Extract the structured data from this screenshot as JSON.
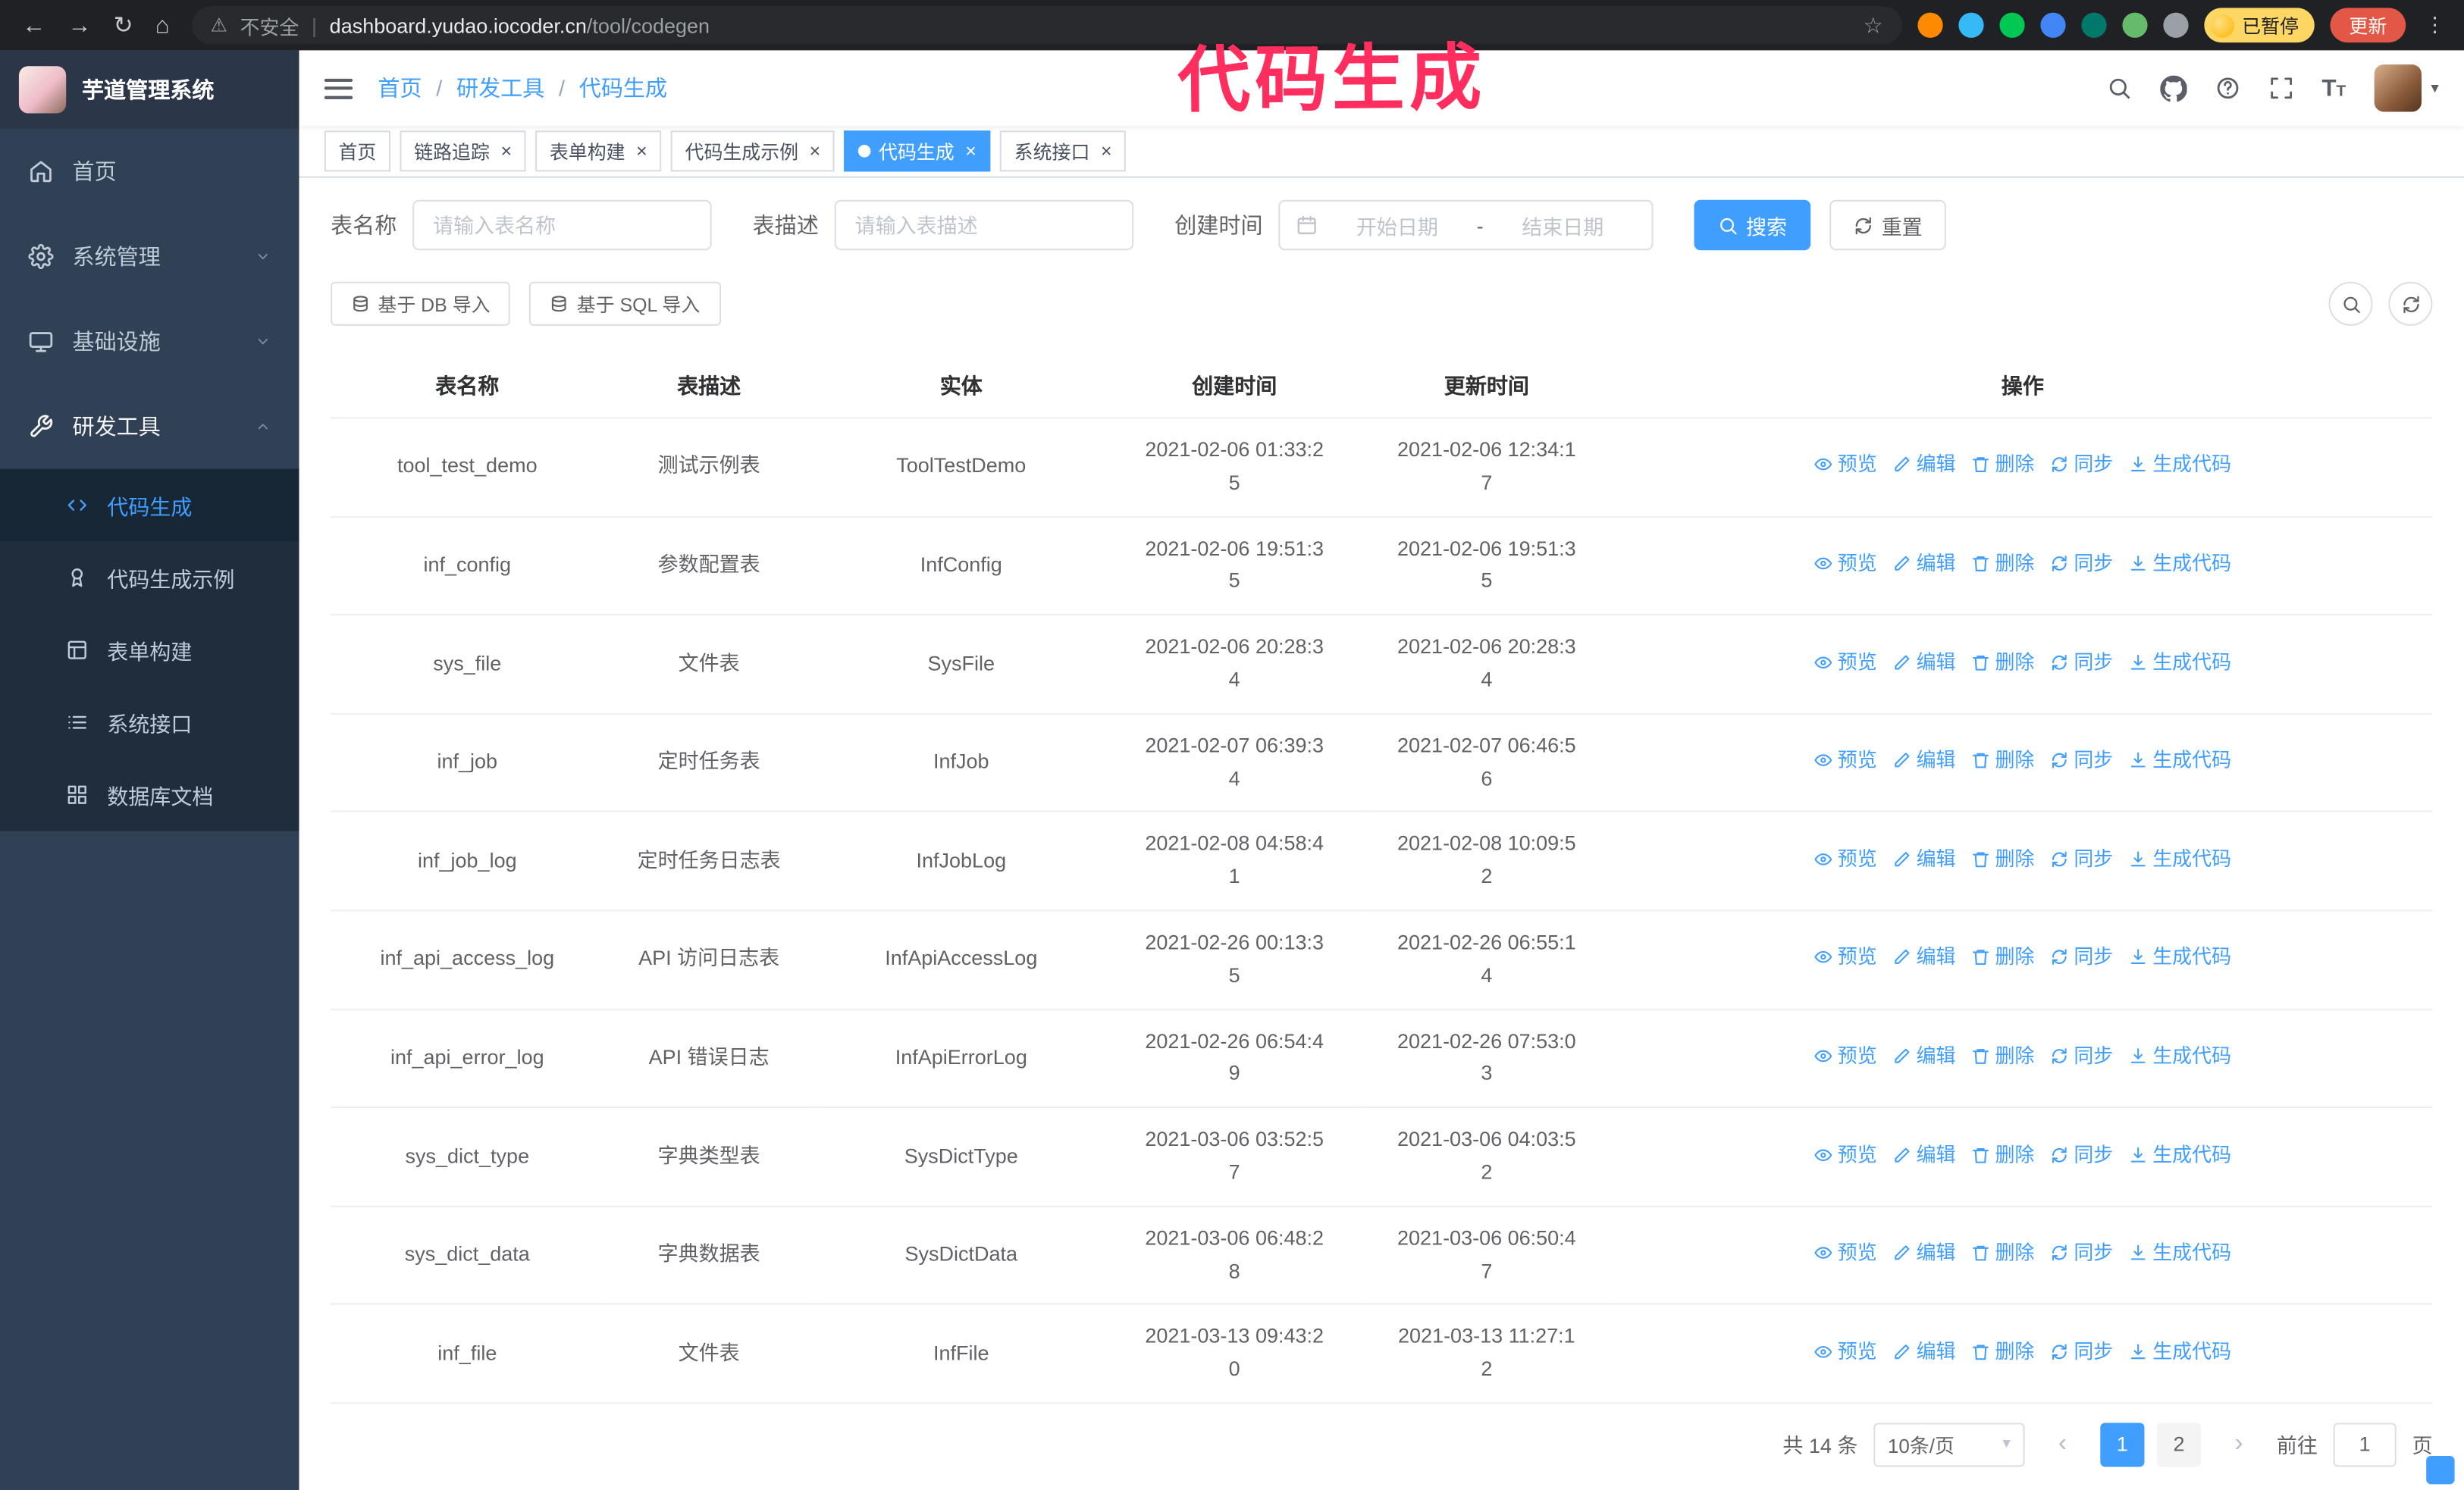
{
  "theme": {
    "accent": "#409eff",
    "sidebar_bg": "#304156",
    "annotation_color": "#ff2e5f",
    "active_tab_bg": "#409eff",
    "update_button_bg": "#e25746",
    "paused_chip_bg": "#fdd663"
  },
  "browser": {
    "security_label": "不安全",
    "url_domain": "dashboard.yudao.iocoder.cn",
    "url_path": "/tool/codegen",
    "paused_badge": "已暂停",
    "update_button": "更新",
    "extensions": [
      {
        "name": "orange-extension-icon",
        "color": "#ff8a00"
      },
      {
        "name": "blue-drop-extension-icon",
        "color": "#35baf6"
      },
      {
        "name": "green-check-extension-icon",
        "color": "#00c853"
      },
      {
        "name": "blue-square-extension-icon",
        "color": "#4285f4"
      },
      {
        "name": "teal-extension-icon",
        "color": "#00796b"
      },
      {
        "name": "green-leaf-extension-icon",
        "color": "#66bb6a"
      },
      {
        "name": "puzzle-extension-icon",
        "color": "#9aa0a6"
      }
    ]
  },
  "annotation": {
    "text": "代码生成"
  },
  "sidebar": {
    "logo_title": "芋道管理系统",
    "menu": [
      {
        "label": "首页",
        "icon": "dashboard-icon",
        "expandable": false,
        "expanded": false
      },
      {
        "label": "系统管理",
        "icon": "gear-icon",
        "expandable": true,
        "expanded": false
      },
      {
        "label": "基础设施",
        "icon": "infra-icon",
        "expandable": true,
        "expanded": false
      },
      {
        "label": "研发工具",
        "icon": "tools-icon",
        "expandable": true,
        "expanded": true
      }
    ],
    "submenu": [
      {
        "label": "代码生成",
        "icon": "code-icon",
        "active": true
      },
      {
        "label": "代码生成示例",
        "icon": "example-icon",
        "active": false
      },
      {
        "label": "表单构建",
        "icon": "form-icon",
        "active": false
      },
      {
        "label": "系统接口",
        "icon": "api-icon",
        "active": false
      },
      {
        "label": "数据库文档",
        "icon": "db-icon",
        "active": false
      }
    ]
  },
  "header": {
    "breadcrumb": [
      {
        "label": "首页"
      },
      {
        "label": "研发工具"
      },
      {
        "label": "代码生成"
      }
    ],
    "icons": [
      "search-icon",
      "github-icon",
      "question-icon",
      "fullscreen-icon",
      "font-size-icon"
    ]
  },
  "tabs": [
    {
      "label": "首页",
      "closable": false,
      "active": false
    },
    {
      "label": "链路追踪",
      "closable": true,
      "active": false
    },
    {
      "label": "表单构建",
      "closable": true,
      "active": false
    },
    {
      "label": "代码生成示例",
      "closable": true,
      "active": false
    },
    {
      "label": "代码生成",
      "closable": true,
      "active": true
    },
    {
      "label": "系统接口",
      "closable": true,
      "active": false
    }
  ],
  "filters": {
    "table_name_label": "表名称",
    "table_name_placeholder": "请输入表名称",
    "table_desc_label": "表描述",
    "table_desc_placeholder": "请输入表描述",
    "create_time_label": "创建时间",
    "date_start_placeholder": "开始日期",
    "date_separator": "-",
    "date_end_placeholder": "结束日期",
    "search_button": "搜索",
    "reset_button": "重置"
  },
  "toolbar": {
    "import_db": "基于 DB 导入",
    "import_sql": "基于 SQL 导入"
  },
  "table": {
    "columns": [
      "表名称",
      "表描述",
      "实体",
      "创建时间",
      "更新时间",
      "操作"
    ],
    "actions": [
      "预览",
      "编辑",
      "删除",
      "同步",
      "生成代码"
    ],
    "rows": [
      {
        "name": "tool_test_demo",
        "desc": "测试示例表",
        "entity": "ToolTestDemo",
        "created": "2021-02-06 01:33:25",
        "updated": "2021-02-06 12:34:17"
      },
      {
        "name": "inf_config",
        "desc": "参数配置表",
        "entity": "InfConfig",
        "created": "2021-02-06 19:51:35",
        "updated": "2021-02-06 19:51:35"
      },
      {
        "name": "sys_file",
        "desc": "文件表",
        "entity": "SysFile",
        "created": "2021-02-06 20:28:34",
        "updated": "2021-02-06 20:28:34"
      },
      {
        "name": "inf_job",
        "desc": "定时任务表",
        "entity": "InfJob",
        "created": "2021-02-07 06:39:34",
        "updated": "2021-02-07 06:46:56"
      },
      {
        "name": "inf_job_log",
        "desc": "定时任务日志表",
        "entity": "InfJobLog",
        "created": "2021-02-08 04:58:41",
        "updated": "2021-02-08 10:09:52"
      },
      {
        "name": "inf_api_access_log",
        "desc": "API 访问日志表",
        "entity": "InfApiAccessLog",
        "created": "2021-02-26 00:13:35",
        "updated": "2021-02-26 06:55:14"
      },
      {
        "name": "inf_api_error_log",
        "desc": "API 错误日志",
        "entity": "InfApiErrorLog",
        "created": "2021-02-26 06:54:49",
        "updated": "2021-02-26 07:53:03"
      },
      {
        "name": "sys_dict_type",
        "desc": "字典类型表",
        "entity": "SysDictType",
        "created": "2021-03-06 03:52:57",
        "updated": "2021-03-06 04:03:52"
      },
      {
        "name": "sys_dict_data",
        "desc": "字典数据表",
        "entity": "SysDictData",
        "created": "2021-03-06 06:48:28",
        "updated": "2021-03-06 06:50:47"
      },
      {
        "name": "inf_file",
        "desc": "文件表",
        "entity": "InfFile",
        "created": "2021-03-13 09:43:20",
        "updated": "2021-03-13 11:27:12"
      }
    ]
  },
  "pagination": {
    "total": "共 14 条",
    "page_size": "10条/页",
    "pages": [
      "1",
      "2"
    ],
    "active_page": "1",
    "goto_label": "前往",
    "goto_value": "1",
    "goto_unit": "页"
  }
}
